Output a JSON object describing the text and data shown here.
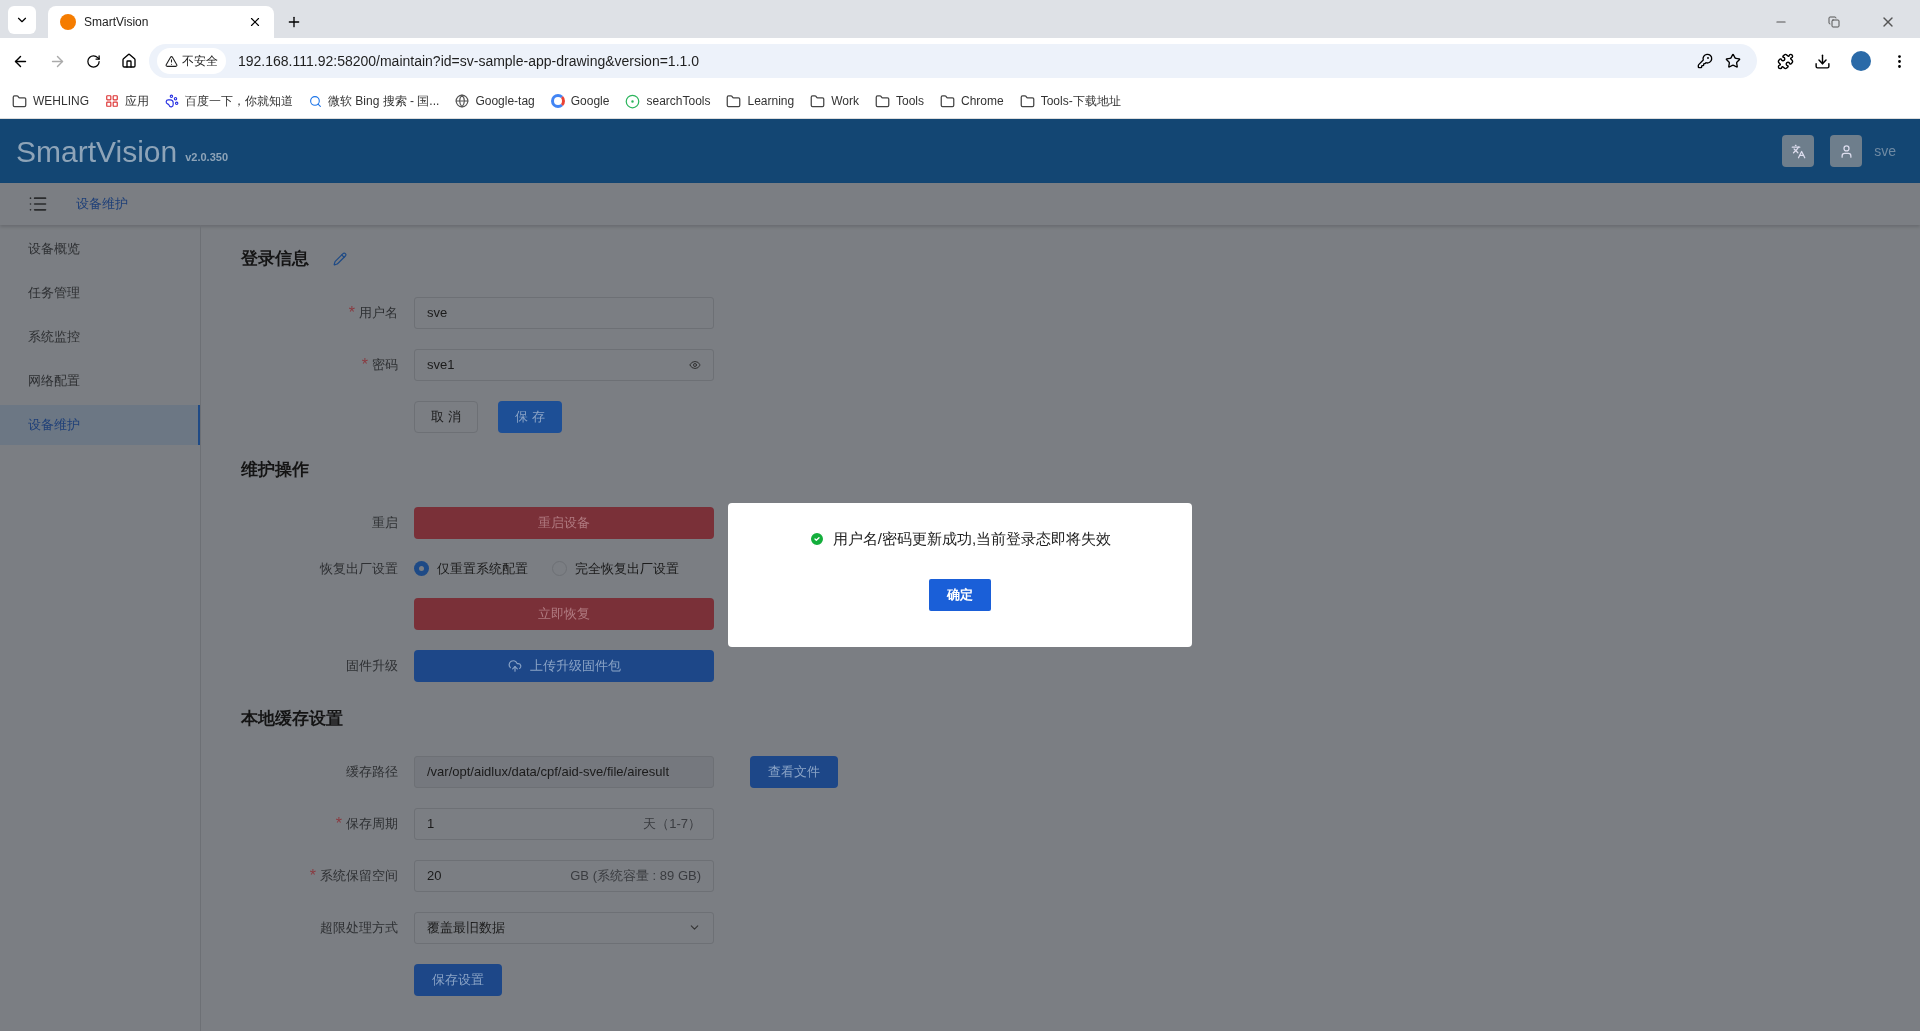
{
  "browser": {
    "tab_title": "SmartVision",
    "security_label": "不安全",
    "url": "192.168.111.92:58200/maintain?id=sv-sample-app-drawing&version=1.1.0",
    "bookmarks": [
      {
        "label": "WEHLING",
        "kind": "folder"
      },
      {
        "label": "应用",
        "kind": "apps"
      },
      {
        "label": "百度一下，你就知道",
        "kind": "paw"
      },
      {
        "label": "微软 Bing 搜索 - 国...",
        "kind": "search"
      },
      {
        "label": "Google-tag",
        "kind": "globe"
      },
      {
        "label": "Google",
        "kind": "letter"
      },
      {
        "label": "searchTools",
        "kind": "circle"
      },
      {
        "label": "Learning",
        "kind": "folder"
      },
      {
        "label": "Work",
        "kind": "folder"
      },
      {
        "label": "Tools",
        "kind": "folder"
      },
      {
        "label": "Chrome",
        "kind": "folder"
      },
      {
        "label": "Tools-下载地址",
        "kind": "folder"
      }
    ]
  },
  "header": {
    "brand": "SmartVision",
    "version": "v2.0.350",
    "user": "sve"
  },
  "breadcrumb": "设备维护",
  "sidebar": {
    "items": [
      {
        "label": "设备概览",
        "selected": false
      },
      {
        "label": "任务管理",
        "selected": false
      },
      {
        "label": "系统监控",
        "selected": false
      },
      {
        "label": "网络配置",
        "selected": false
      },
      {
        "label": "设备维护",
        "selected": true
      }
    ]
  },
  "login": {
    "title": "登录信息",
    "fields": [
      {
        "label": "用户名",
        "required_mark": "*",
        "value": "sve",
        "kind": "text"
      },
      {
        "label": "密码",
        "required_mark": "*",
        "value": "sve1",
        "kind": "password"
      }
    ],
    "cancel": "取 消",
    "save": "保 存"
  },
  "maintenance": {
    "title": "维护操作",
    "restart_label": "重启",
    "restart_button": "重启设备",
    "reset_label": "恢复出厂设置",
    "reset_options": [
      {
        "label": "仅重置系统配置",
        "selected": true
      },
      {
        "label": "完全恢复出厂设置",
        "selected": false
      }
    ],
    "reset_button": "立即恢复",
    "firmware_label": "固件升级",
    "firmware_button": "上传升级固件包"
  },
  "cache": {
    "title": "本地缓存设置",
    "path_label": "缓存路径",
    "path_value": "/var/opt/aidlux/data/cpf/aid-sve/file/airesult",
    "view_button": "查看文件",
    "fields": [
      {
        "label": "保存周期",
        "required_mark": "*",
        "value": "1",
        "suffix": "天（1-7）"
      },
      {
        "label": "系统保留空间",
        "required_mark": "*",
        "value": "20",
        "suffix": "GB (系统容量 : 89 GB)"
      }
    ],
    "mode_label": "超限处理方式",
    "mode_value": "覆盖最旧数据",
    "save_button": "保存设置"
  },
  "dialog": {
    "message": "用户名/密码更新成功,当前登录态即将失效",
    "confirm": "确定"
  }
}
